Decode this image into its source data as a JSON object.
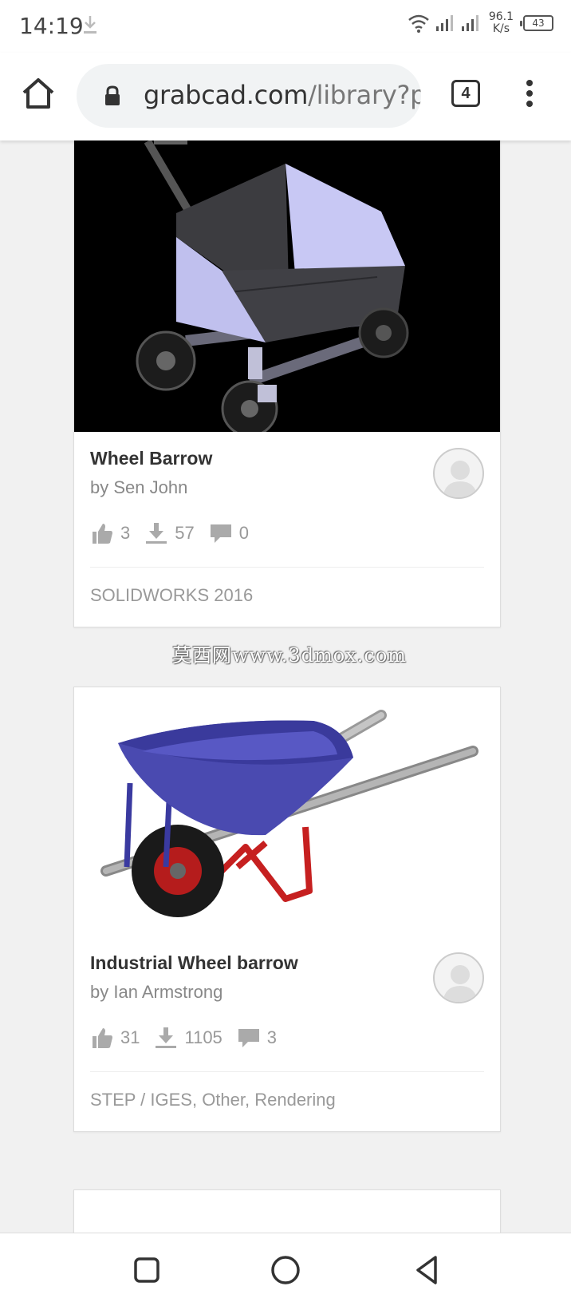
{
  "status": {
    "time": "14:19",
    "speed_value": "96.1",
    "speed_unit": "K/s",
    "battery": "43"
  },
  "browser": {
    "url_domain": "grabcad.com",
    "url_path": "/library?pa",
    "tab_count": "4"
  },
  "cards": [
    {
      "title": "Wheel Barrow",
      "author": "by Sen John",
      "likes": "3",
      "downloads": "57",
      "comments": "0",
      "software": "SOLIDWORKS 2016"
    },
    {
      "title": "Industrial Wheel barrow",
      "author": "by Ian Armstrong",
      "likes": "31",
      "downloads": "1105",
      "comments": "3",
      "software": "STEP / IGES, Other, Rendering"
    }
  ],
  "watermark": "莫西网www.3dmox.com",
  "icons": {
    "home": "home-icon",
    "lock": "lock-icon",
    "like": "thumbs-up-icon",
    "download": "download-icon",
    "comment": "comment-icon",
    "recents": "square-icon",
    "home_nav": "circle-icon",
    "back": "triangle-back-icon"
  }
}
